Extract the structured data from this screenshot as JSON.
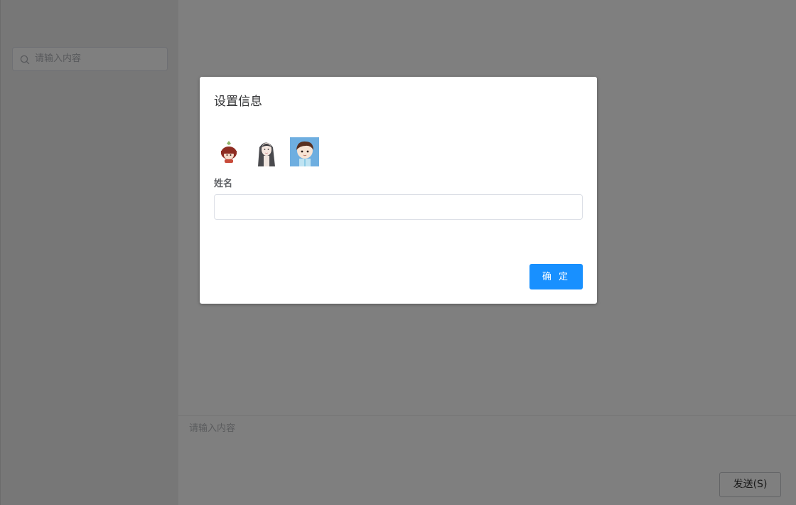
{
  "sidebar": {
    "search": {
      "placeholder": "请输入内容",
      "icon": "search-icon"
    }
  },
  "composer": {
    "placeholder": "请输入内容",
    "send_label": "发送(S)"
  },
  "dialog": {
    "title": "设置信息",
    "avatars": [
      {
        "name": "avatar-girl-red-hair-icon"
      },
      {
        "name": "avatar-girl-long-hair-icon"
      },
      {
        "name": "avatar-boy-icon"
      }
    ],
    "name_label": "姓名",
    "name_value": "",
    "confirm_label": "确 定"
  },
  "colors": {
    "primary": "#1890ff",
    "overlay": "#000000"
  }
}
